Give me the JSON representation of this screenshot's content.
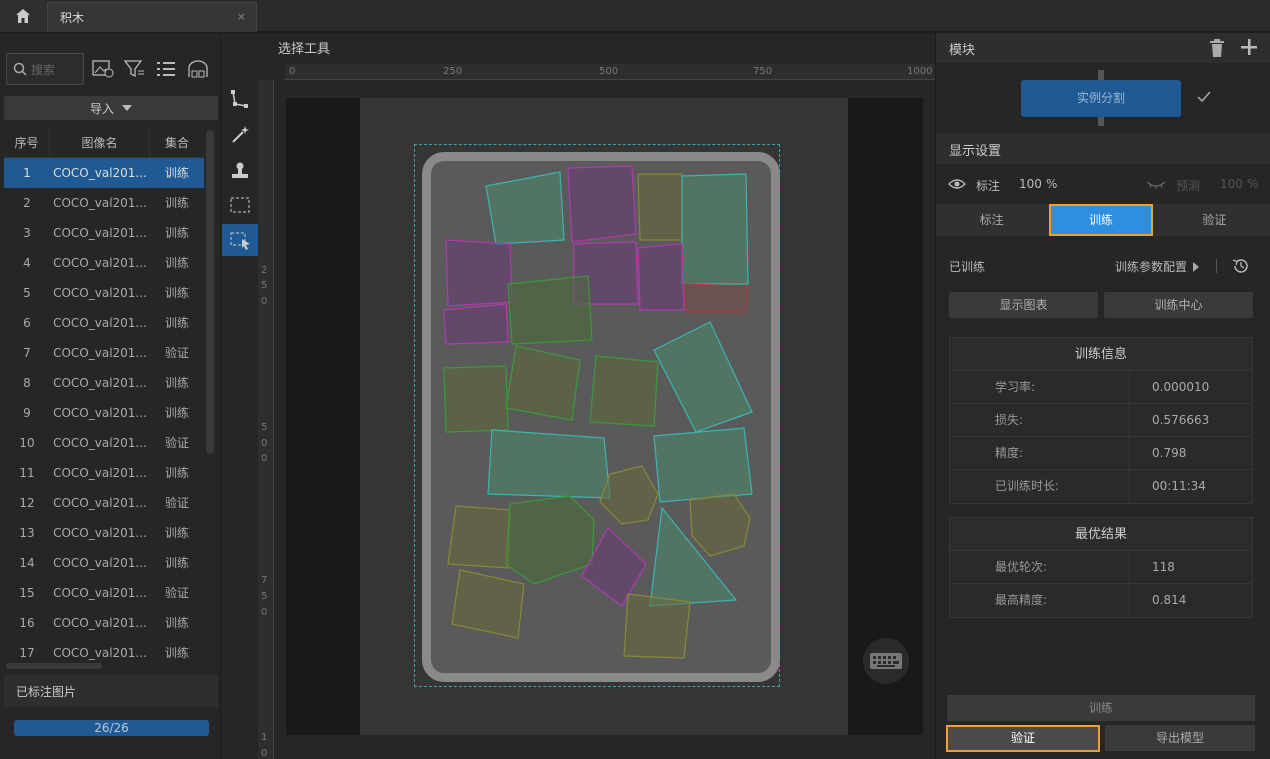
{
  "tab": {
    "title": "积木",
    "close": "×"
  },
  "left": {
    "search_placeholder": "搜索",
    "import_label": "导入",
    "columns": {
      "index": "序号",
      "name": "图像名",
      "set": "集合"
    },
    "rows": [
      {
        "i": "1",
        "name": "COCO_val201...",
        "set": "训练"
      },
      {
        "i": "2",
        "name": "COCO_val201...",
        "set": "训练"
      },
      {
        "i": "3",
        "name": "COCO_val201...",
        "set": "训练"
      },
      {
        "i": "4",
        "name": "COCO_val201...",
        "set": "训练"
      },
      {
        "i": "5",
        "name": "COCO_val201...",
        "set": "训练"
      },
      {
        "i": "6",
        "name": "COCO_val201...",
        "set": "训练"
      },
      {
        "i": "7",
        "name": "COCO_val201...",
        "set": "验证"
      },
      {
        "i": "8",
        "name": "COCO_val201...",
        "set": "训练"
      },
      {
        "i": "9",
        "name": "COCO_val201...",
        "set": "训练"
      },
      {
        "i": "10",
        "name": "COCO_val201...",
        "set": "验证"
      },
      {
        "i": "11",
        "name": "COCO_val201...",
        "set": "训练"
      },
      {
        "i": "12",
        "name": "COCO_val201...",
        "set": "验证"
      },
      {
        "i": "13",
        "name": "COCO_val201...",
        "set": "训练"
      },
      {
        "i": "14",
        "name": "COCO_val201...",
        "set": "训练"
      },
      {
        "i": "15",
        "name": "COCO_val201...",
        "set": "验证"
      },
      {
        "i": "16",
        "name": "COCO_val201...",
        "set": "训练"
      },
      {
        "i": "17",
        "name": "COCO_val201...",
        "set": "训练"
      }
    ],
    "labeled_title": "已标注图片",
    "progress_text": "26/26",
    "progress_fraction": 1.0
  },
  "center": {
    "title": "选择工具",
    "ruler_h": [
      "0",
      "250",
      "500",
      "750",
      "1000"
    ],
    "ruler_v": [
      "2",
      "5",
      "0",
      "5",
      "0",
      "0",
      "7",
      "5",
      "0",
      "1",
      "0"
    ]
  },
  "right": {
    "module_title": "模块",
    "module_name": "实例分割",
    "display_settings": "显示设置",
    "label_toggle": "标注",
    "label_opacity": "100",
    "predict_toggle": "预测",
    "predict_opacity": "100",
    "percent": "%",
    "tabs": {
      "label": "标注",
      "train": "训练",
      "verify": "验证"
    },
    "trained_status": "已训练",
    "train_params": "训练参数配置",
    "show_chart": "显示图表",
    "train_center": "训练中心",
    "train_info": {
      "title": "训练信息",
      "rows": [
        {
          "k": "学习率:",
          "v": "0.000010"
        },
        {
          "k": "损失:",
          "v": "0.576663"
        },
        {
          "k": "精度:",
          "v": "0.798"
        },
        {
          "k": "已训练时长:",
          "v": "00:11:34"
        }
      ]
    },
    "best": {
      "title": "最优结果",
      "rows": [
        {
          "k": "最优轮次:",
          "v": "118"
        },
        {
          "k": "最高精度:",
          "v": "0.814"
        }
      ]
    },
    "btn_train": "训练",
    "btn_verify": "验证",
    "btn_export": "导出模型"
  }
}
